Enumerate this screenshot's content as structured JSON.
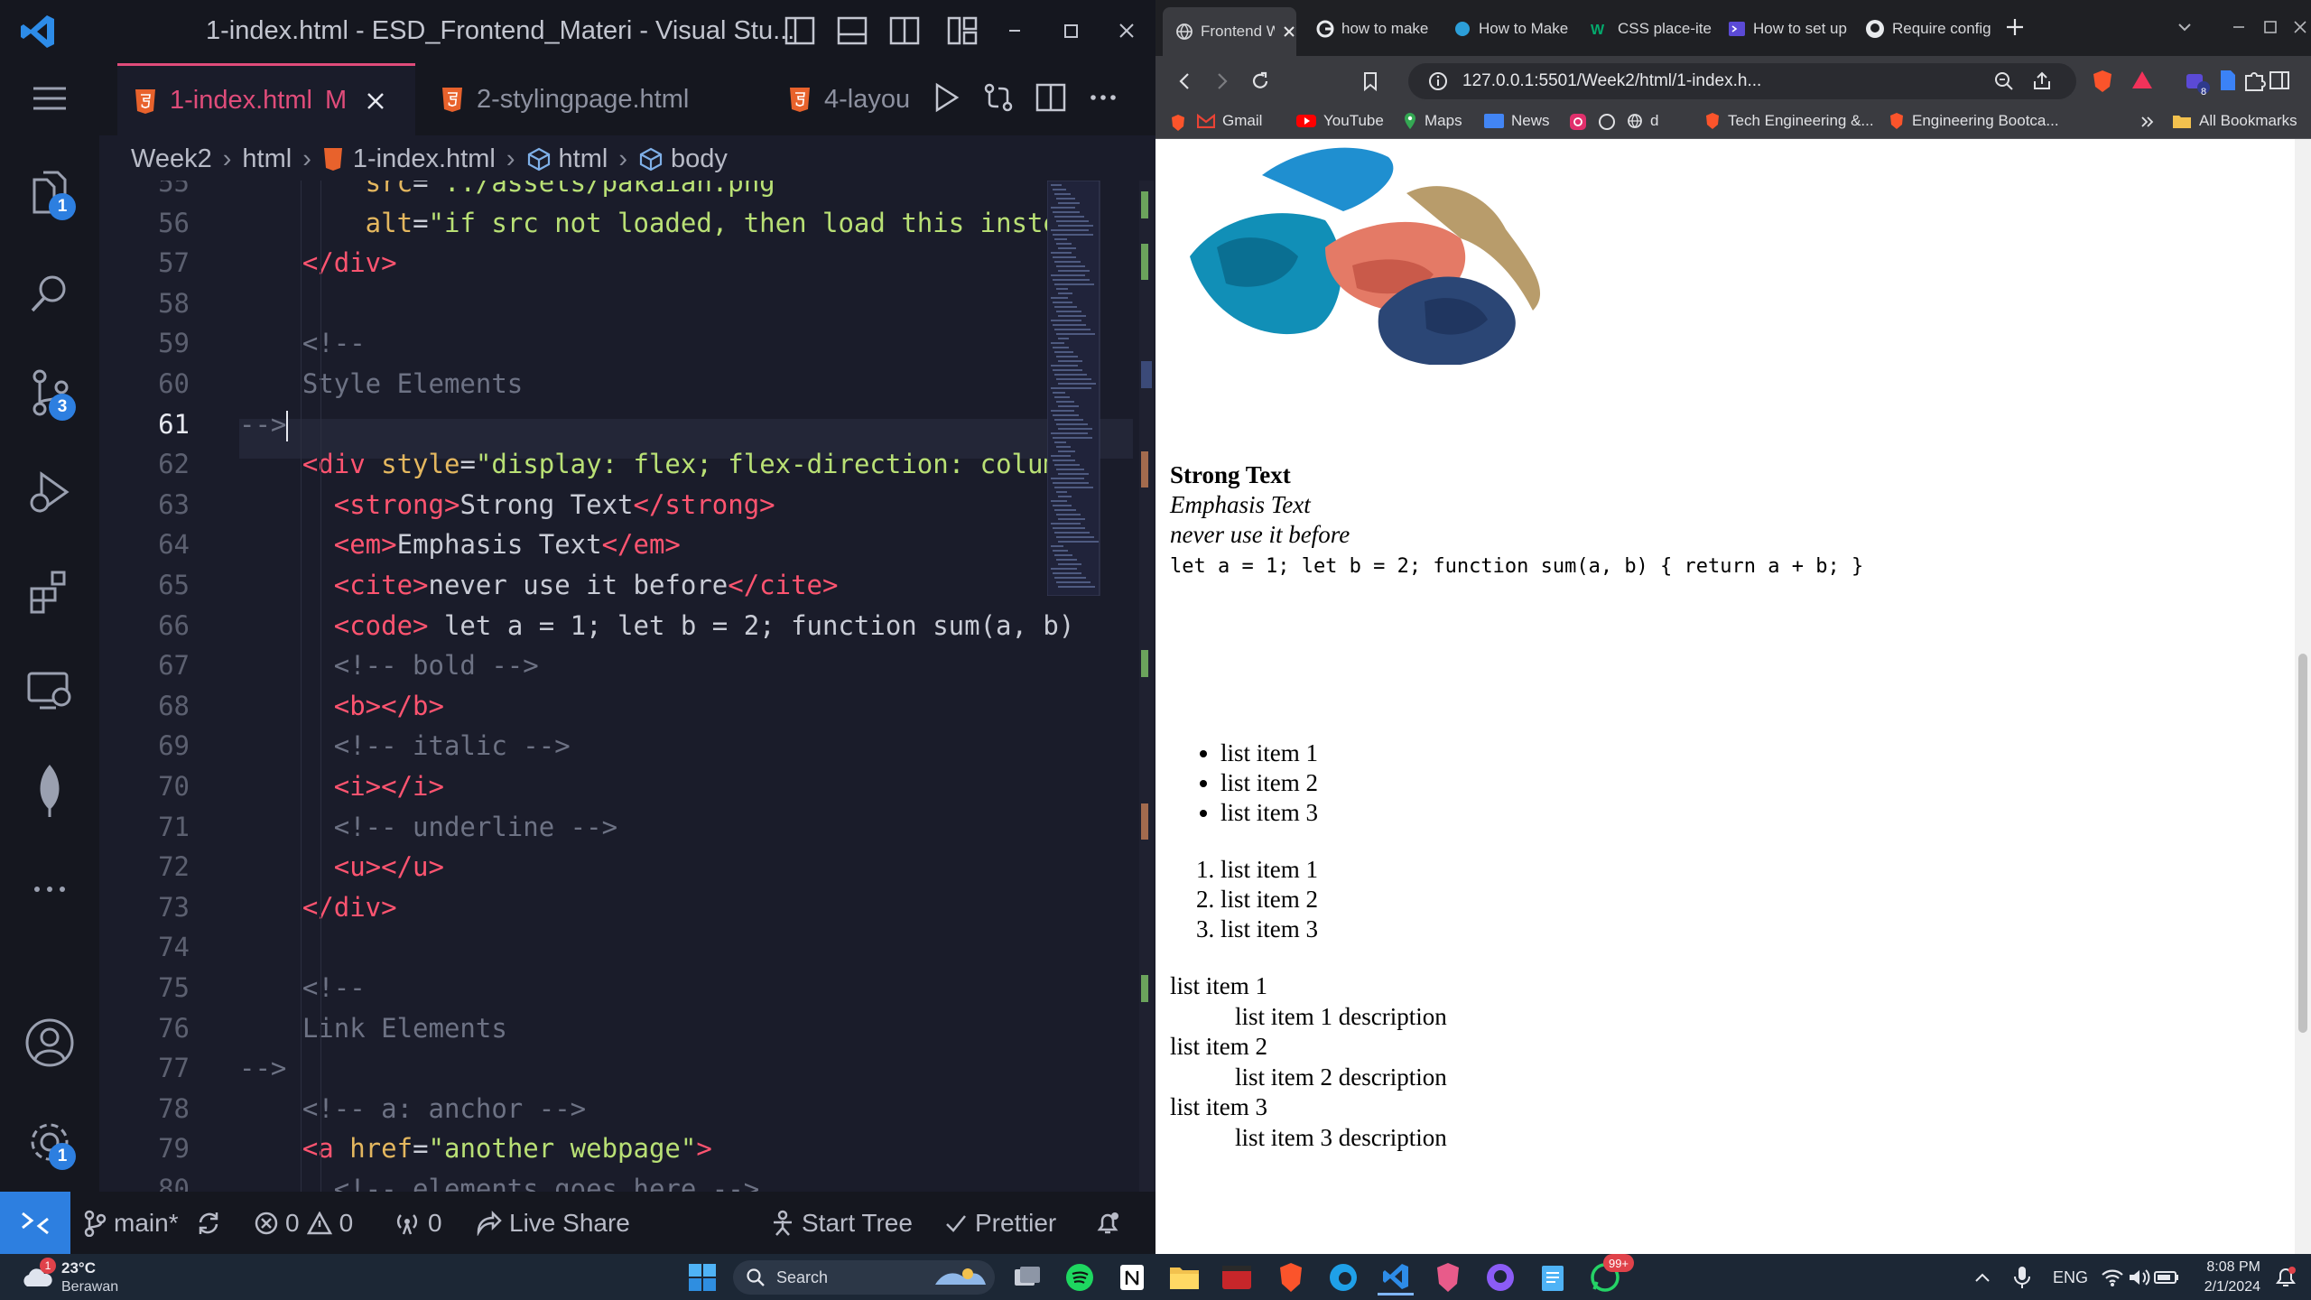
{
  "vscode": {
    "window_title": "1-index.html - ESD_Frontend_Materi - Visual Stu...",
    "tabs": [
      {
        "label": "1-index.html",
        "modified": "M"
      },
      {
        "label": "2-stylingpage.html"
      },
      {
        "label": "4-layou"
      }
    ],
    "breadcrumb": [
      "Week2",
      "html",
      "1-index.html",
      "html",
      "body"
    ],
    "activity_badges": {
      "explorer": "1",
      "source_control": "3",
      "settings": "1"
    },
    "code_lines": [
      {
        "n": "55",
        "segs": [
          [
            "at",
            "        src"
          ],
          [
            "tx",
            "="
          ],
          [
            "st",
            "\"../assets/pakaian.png\""
          ]
        ]
      },
      {
        "n": "56",
        "segs": [
          [
            "at",
            "        alt"
          ],
          [
            "tx",
            "="
          ],
          [
            "st",
            "\"if src not loaded, then load this instea"
          ]
        ]
      },
      {
        "n": "57",
        "segs": [
          [
            "tg",
            "    </div>"
          ]
        ]
      },
      {
        "n": "58",
        "segs": []
      },
      {
        "n": "59",
        "segs": [
          [
            "cm",
            "    <!--"
          ]
        ]
      },
      {
        "n": "60",
        "segs": [
          [
            "cm",
            "    Style Elements"
          ]
        ]
      },
      {
        "n": "61",
        "segs": [
          [
            "cm",
            "-->"
          ]
        ],
        "current": true
      },
      {
        "n": "62",
        "segs": [
          [
            "tg",
            "    <div "
          ],
          [
            "at",
            "style"
          ],
          [
            "tx",
            "="
          ],
          [
            "st",
            "\"display: flex; flex-direction: column"
          ]
        ]
      },
      {
        "n": "63",
        "segs": [
          [
            "tg",
            "      <strong>"
          ],
          [
            "tx",
            "Strong Text"
          ],
          [
            "tg",
            "</strong>"
          ]
        ]
      },
      {
        "n": "64",
        "segs": [
          [
            "tg",
            "      <em>"
          ],
          [
            "tx",
            "Emphasis Text"
          ],
          [
            "tg",
            "</em>"
          ]
        ]
      },
      {
        "n": "65",
        "segs": [
          [
            "tg",
            "      <cite>"
          ],
          [
            "tx",
            "never use it before"
          ],
          [
            "tg",
            "</cite>"
          ]
        ]
      },
      {
        "n": "66",
        "segs": [
          [
            "tg",
            "      <code>"
          ],
          [
            "tx",
            " let a = 1; let b = 2; function sum(a, b)"
          ]
        ]
      },
      {
        "n": "67",
        "segs": [
          [
            "cm",
            "      <!-- bold -->"
          ]
        ]
      },
      {
        "n": "68",
        "segs": [
          [
            "tg",
            "      <b></b>"
          ]
        ]
      },
      {
        "n": "69",
        "segs": [
          [
            "cm",
            "      <!-- italic -->"
          ]
        ]
      },
      {
        "n": "70",
        "segs": [
          [
            "tg",
            "      <i></i>"
          ]
        ]
      },
      {
        "n": "71",
        "segs": [
          [
            "cm",
            "      <!-- underline -->"
          ]
        ]
      },
      {
        "n": "72",
        "segs": [
          [
            "tg",
            "      <u></u>"
          ]
        ]
      },
      {
        "n": "73",
        "segs": [
          [
            "tg",
            "    </div>"
          ]
        ]
      },
      {
        "n": "74",
        "segs": []
      },
      {
        "n": "75",
        "segs": [
          [
            "cm",
            "    <!--"
          ]
        ]
      },
      {
        "n": "76",
        "segs": [
          [
            "cm",
            "    Link Elements"
          ]
        ]
      },
      {
        "n": "77",
        "segs": [
          [
            "cm",
            "-->"
          ]
        ]
      },
      {
        "n": "78",
        "segs": [
          [
            "cm",
            "    <!-- a: anchor -->"
          ]
        ]
      },
      {
        "n": "79",
        "segs": [
          [
            "tg",
            "    <a "
          ],
          [
            "at",
            "href"
          ],
          [
            "tx",
            "="
          ],
          [
            "st",
            "\"another webpage\""
          ],
          [
            "tg",
            ">"
          ]
        ]
      },
      {
        "n": "80",
        "segs": [
          [
            "cm",
            "      <!-- elements goes here -->"
          ]
        ]
      }
    ],
    "status": {
      "branch": "main*",
      "errors": "0",
      "warnings": "0",
      "ports": "0",
      "live_share": "Live Share",
      "start_tree": "Start Tree",
      "prettier": "Prettier"
    }
  },
  "browser": {
    "tabs": [
      "Frontend W",
      "how to make",
      "How to Make",
      "CSS place-item",
      "How to set up",
      "Require config"
    ],
    "url": "127.0.0.1:5501/Week2/html/1-index.h...",
    "vpn_label": "VPN",
    "extension_badge": "8",
    "bookmarks": [
      "Gmail",
      "YouTube",
      "Maps",
      "News",
      "d",
      "Tech Engineering &...",
      "Engineering Bootca..."
    ],
    "all_bookmarks": "All Bookmarks",
    "page": {
      "strong": "Strong Text",
      "em": "Emphasis Text",
      "cite": "never use it before",
      "code": "let a = 1; let b = 2; function sum(a, b) { return a + b; }",
      "ul": [
        "list item 1",
        "list item 2",
        "list item 3"
      ],
      "ol": [
        "list item 1",
        "list item 2",
        "list item 3"
      ],
      "dl": [
        {
          "term": "list item 1",
          "desc": "list item 1 description"
        },
        {
          "term": "list item 2",
          "desc": "list item 2 description"
        },
        {
          "term": "list item 3",
          "desc": "list item 3 description"
        }
      ]
    }
  },
  "taskbar": {
    "weather_temp": "23°C",
    "weather_desc": "Berawan",
    "weather_badge": "1",
    "search_placeholder": "Search",
    "whatsapp_badge": "99+",
    "language": "ENG",
    "time": "8:08 PM",
    "date": "2/1/2024"
  },
  "colors": {
    "accent": "#2d7fe0",
    "tag": "#ff5470",
    "attr": "#e4b75f",
    "string": "#b9e075",
    "comment": "#6d7284"
  }
}
